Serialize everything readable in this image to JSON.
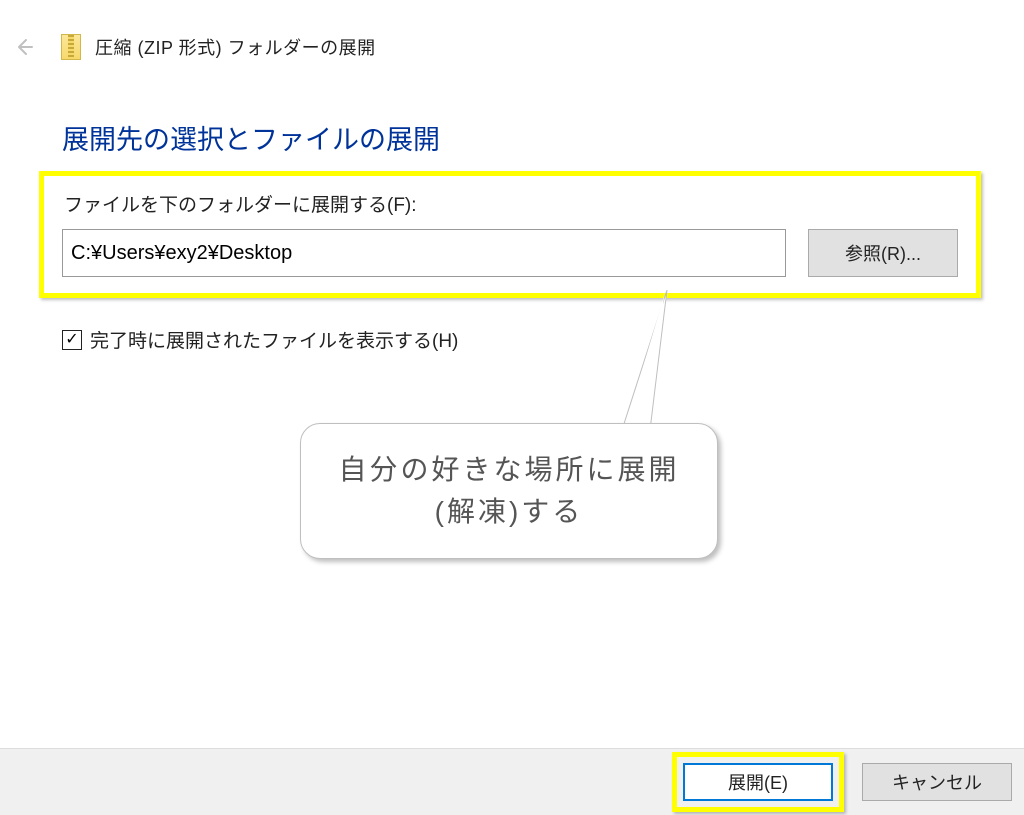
{
  "header": {
    "title": "圧縮 (ZIP 形式) フォルダーの展開"
  },
  "section": {
    "title": "展開先の選択とファイルの展開"
  },
  "field": {
    "label": "ファイルを下のフォルダーに展開する(F):",
    "path": "C:¥Users¥exy2¥Desktop",
    "browse": "参照(R)..."
  },
  "checkbox": {
    "label": "完了時に展開されたファイルを表示する(H)",
    "checked": true
  },
  "callout": {
    "line1": "自分の好きな場所に展開",
    "line2": "(解凍)する"
  },
  "buttons": {
    "extract": "展開(E)",
    "cancel": "キャンセル"
  }
}
